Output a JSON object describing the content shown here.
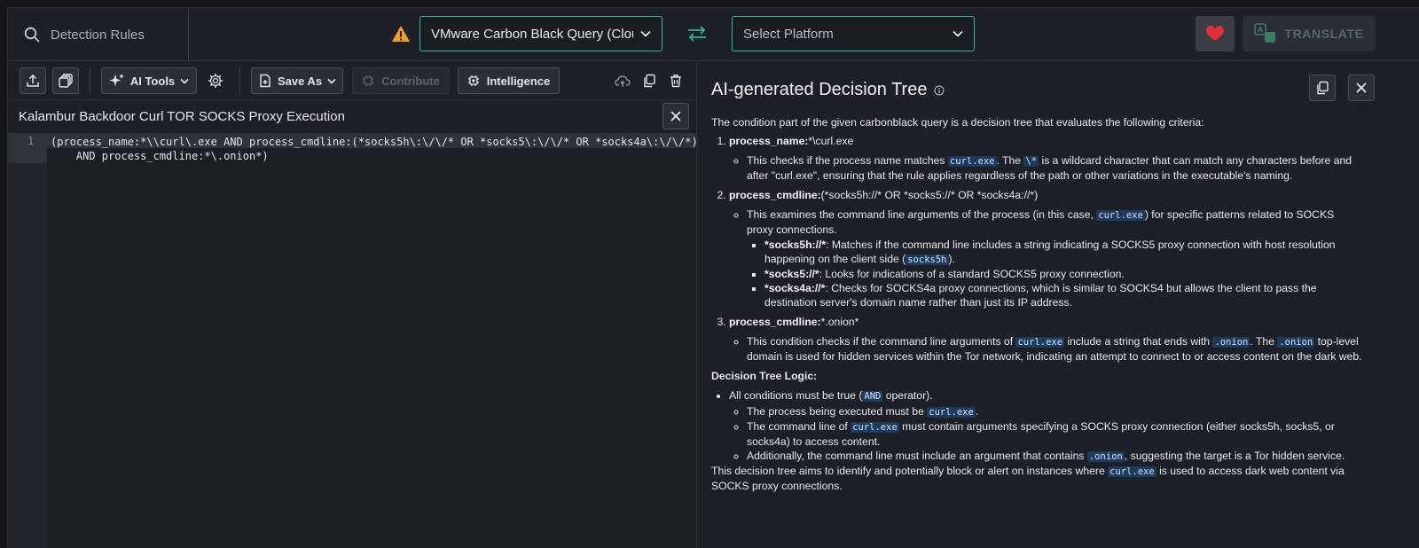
{
  "topbar": {
    "search_label": "Detection Rules",
    "source_select_value": "VMware Carbon Black Query (Cloud)",
    "platform_select_placeholder": "Select Platform",
    "translate_label": "TRANSLATE"
  },
  "toolbar": {
    "ai_tools_label": "AI Tools",
    "save_as_label": "Save As",
    "contribute_label": "Contribute",
    "intelligence_label": "Intelligence"
  },
  "rule": {
    "title": "Kalambur Backdoor Curl TOR SOCKS Proxy Execution",
    "line_number": "1",
    "code_line1": "(process_name:*\\\\curl\\.exe AND process_cmdline:(*socks5h\\:\\/\\/* OR *socks5\\:\\/\\/* OR *socks4a\\:\\/\\/*)",
    "code_line2": "    AND process_cmdline:*\\.onion*)"
  },
  "panel": {
    "title": "AI-generated Decision Tree",
    "intro": "The condition part of the given carbonblack query is a decision tree that evaluates the following criteria:",
    "c1_title": "process_name:",
    "c1_value": "*\\curl.exe",
    "c1_desc_a": "This checks if the process name matches ",
    "c1_code_a": "curl.exe",
    "c1_desc_b": ". The ",
    "c1_code_b": "\\*",
    "c1_desc_c": " is a wildcard character that can match any characters before and after \"curl.exe\", ensuring that the rule applies regardless of the path or other variations in the executable's naming.",
    "c2_title": "process_cmdline:",
    "c2_value": "(*socks5h://* OR *socks5://* OR *socks4a://*)",
    "c2_desc_a": "This examines the command line arguments of the process (in this case, ",
    "c2_code_a": "curl.exe",
    "c2_desc_b": ") for specific patterns related to SOCKS proxy connections.",
    "c2_s1_title": "*socks5h://*",
    "c2_s1_a": ": Matches if the command line includes a string indicating a SOCKS5 proxy connection with host resolution happening on the client side (",
    "c2_s1_code": "socks5h",
    "c2_s1_b": ").",
    "c2_s2_title": "*socks5://*",
    "c2_s2_a": ": Looks for indications of a standard SOCKS5 proxy connection.",
    "c2_s3_title": "*socks4a://*",
    "c2_s3_a": ": Checks for SOCKS4a proxy connections, which is similar to SOCKS4 but allows the client to pass the destination server's domain name rather than just its IP address.",
    "c3_title": "process_cmdline:",
    "c3_value": "*.onion*",
    "c3_desc_a": "This condition checks if the command line arguments of ",
    "c3_code_a": "curl.exe",
    "c3_desc_b": " include a string that ends with ",
    "c3_code_b": ".onion",
    "c3_desc_c": ". The ",
    "c3_code_c": ".onion",
    "c3_desc_d": " top-level domain is used for hidden services within the Tor network, indicating an attempt to connect to or access content on the dark web.",
    "logic_title": "Decision Tree Logic:",
    "l1_a": "All conditions must be true (",
    "l1_code": "AND",
    "l1_b": " operator).",
    "l2_a": "The process being executed must be ",
    "l2_code": "curl.exe",
    "l2_b": ".",
    "l3_a": "The command line of ",
    "l3_code": "curl.exe",
    "l3_b": " must contain arguments specifying a SOCKS proxy connection (either socks5h, socks5, or socks4a) to access content.",
    "l4_a": "Additionally, the command line must include an argument that contains ",
    "l4_code": ".onion",
    "l4_b": ", suggesting the target is a Tor hidden service.",
    "outro_a": "This decision tree aims to identify and potentially block or alert on instances where ",
    "outro_code": "curl.exe",
    "outro_b": " is used to access dark web content via SOCKS proxy connections."
  },
  "colors": {
    "accent_green": "#2fb98a",
    "warning": "#f0a020",
    "heart": "#e0303a",
    "code_highlight": "#1e3a5c"
  }
}
